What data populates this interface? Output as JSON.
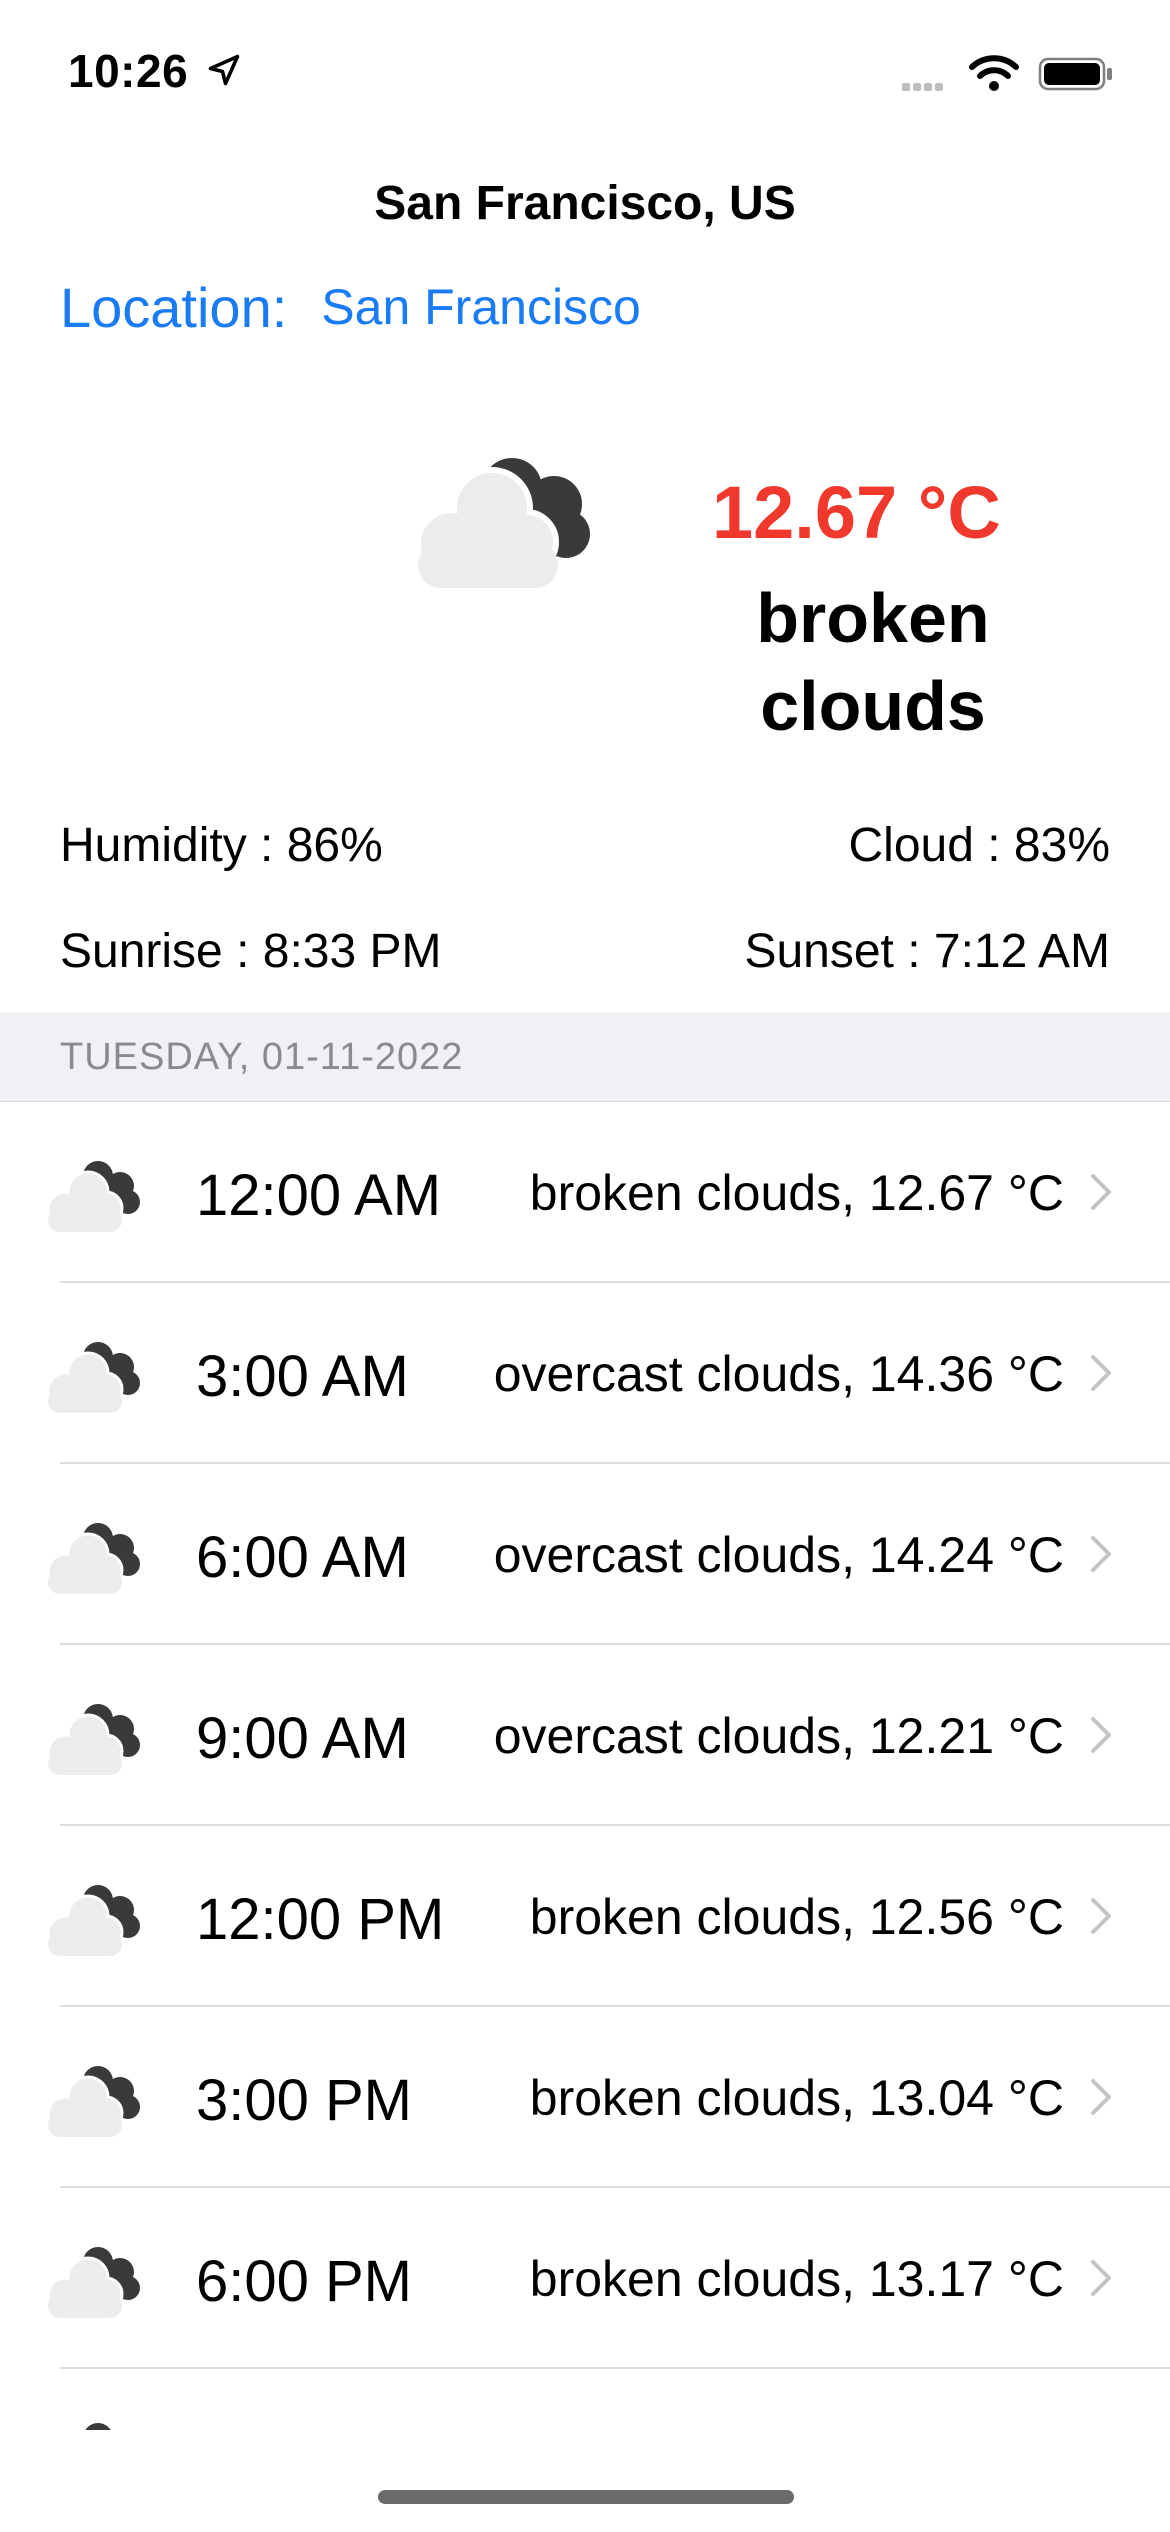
{
  "status_bar": {
    "time": "10:26",
    "icons": [
      "location-arrow-icon",
      "signal-icon",
      "wifi-icon",
      "battery-icon"
    ]
  },
  "header": {
    "title": "San Francisco, US"
  },
  "location": {
    "label": "Location:",
    "value": "San Francisco"
  },
  "current": {
    "icon": "broken-clouds-icon",
    "temperature": "12.67 °C",
    "description_line1": "broken",
    "description_line2": "clouds"
  },
  "stats": {
    "humidity": "Humidity : 86%",
    "cloud": "Cloud : 83%",
    "sunrise": "Sunrise : 8:33 PM",
    "sunset": "Sunset : 7:12 AM"
  },
  "forecast": {
    "section_title": "TUESDAY, 01-11-2022",
    "items": [
      {
        "time": "12:00 AM",
        "summary": "broken clouds, 12.67 °C",
        "icon": "cloud-icon"
      },
      {
        "time": "3:00 AM",
        "summary": "overcast clouds, 14.36 °C",
        "icon": "cloud-icon"
      },
      {
        "time": "6:00 AM",
        "summary": "overcast clouds, 14.24 °C",
        "icon": "cloud-icon"
      },
      {
        "time": "9:00 AM",
        "summary": "overcast clouds, 12.21 °C",
        "icon": "cloud-icon"
      },
      {
        "time": "12:00 PM",
        "summary": "broken clouds, 12.56 °C",
        "icon": "cloud-icon"
      },
      {
        "time": "3:00 PM",
        "summary": "broken clouds, 13.04 °C",
        "icon": "cloud-icon"
      },
      {
        "time": "6:00 PM",
        "summary": "broken clouds, 13.17 °C",
        "icon": "cloud-icon"
      }
    ]
  },
  "colors": {
    "accent_blue": "#1a7cf5",
    "temperature_red": "#f0382d",
    "section_bg": "#f1f1f5"
  }
}
